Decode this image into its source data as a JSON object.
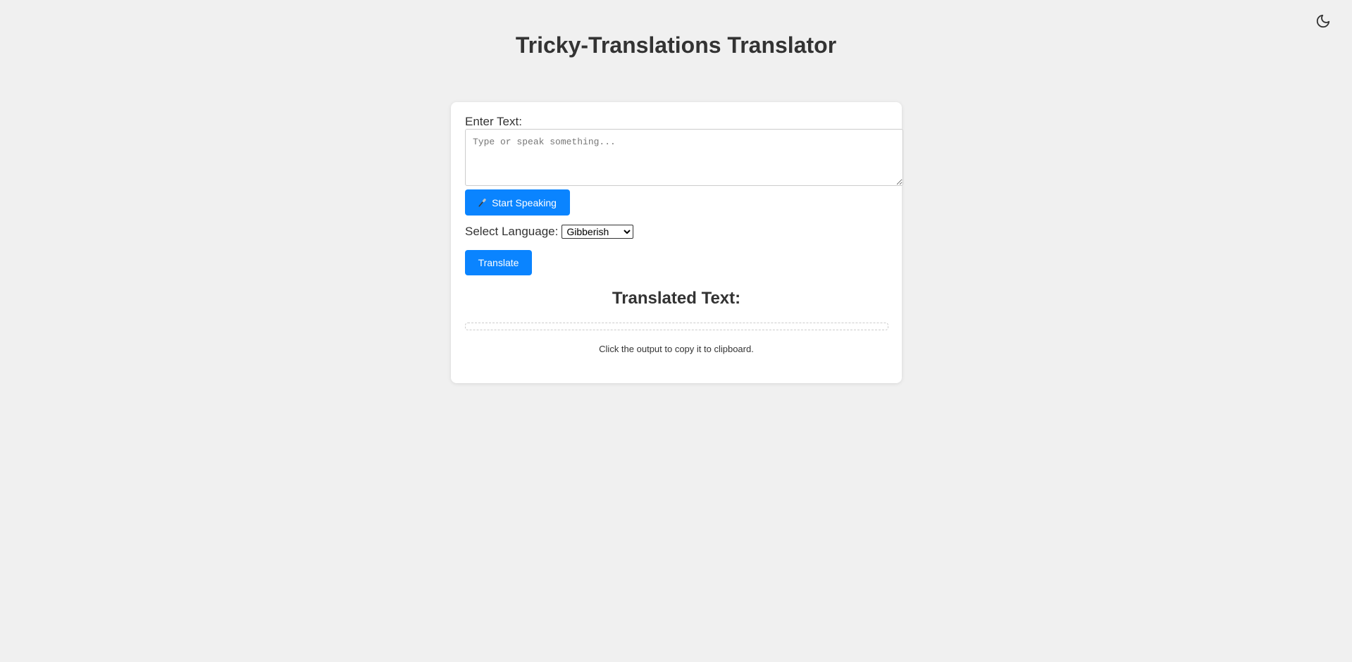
{
  "header": {
    "title": "Tricky-Translations Translator",
    "theme_toggle_icon": "moon-icon"
  },
  "form": {
    "input_label": "Enter Text:",
    "input_placeholder": "Type or speak something...",
    "input_value": "",
    "speak_button_label": "Start Speaking",
    "speak_button_icon": "microphone-icon",
    "language_label": "Select Language:",
    "language_selected": "Gibberish",
    "translate_button_label": "Translate"
  },
  "output": {
    "heading": "Translated Text:",
    "value": "",
    "hint": "Click the output to copy it to clipboard."
  },
  "colors": {
    "accent": "#0a84ff",
    "background": "#f0f0f0",
    "card": "#ffffff",
    "text": "#333333"
  }
}
